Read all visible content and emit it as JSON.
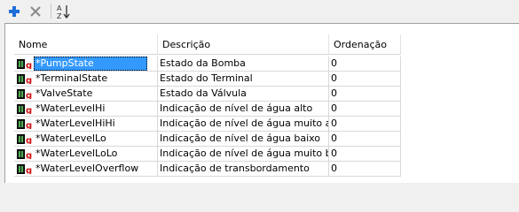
{
  "toolbar": {
    "add_icon": "plus-icon",
    "remove_icon": "x-icon",
    "sort_icon": "sort-az-icon"
  },
  "columns": [
    "Nome",
    "Descrição",
    "Ordenação"
  ],
  "rows": [
    {
      "name": "*PumpState",
      "description": "Estado da Bomba",
      "order": "0"
    },
    {
      "name": "*TerminalState",
      "description": "Estado do Terminal",
      "order": "0"
    },
    {
      "name": "*ValveState",
      "description": "Estado da Válvula",
      "order": "0"
    },
    {
      "name": "*WaterLevelHi",
      "description": "Indicação de nível de água alto",
      "order": "0"
    },
    {
      "name": "*WaterLevelHiHi",
      "description": "Indicação de nível de água muito alto",
      "order": "0"
    },
    {
      "name": "*WaterLevelLo",
      "description": "Indicação de nível de água baixo",
      "order": "0"
    },
    {
      "name": "*WaterLevelLoLo",
      "description": "Indicação de nível de água muito baixo",
      "order": "0"
    },
    {
      "name": "*WaterLevelOverflow",
      "description": "Indicação de transbordamento",
      "order": "0"
    }
  ],
  "selected_row": 0,
  "colors": {
    "accent": "#1e6fd9",
    "selection": "#3399ff",
    "icon_red": "#d01010"
  }
}
